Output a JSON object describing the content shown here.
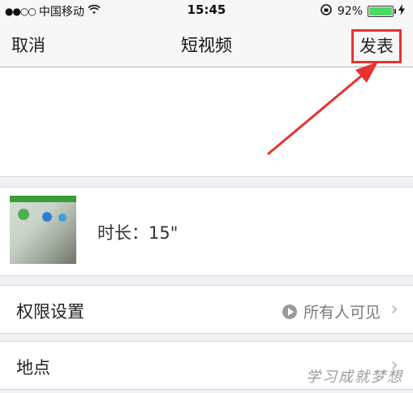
{
  "status_bar": {
    "signal_dots": "●●○○",
    "carrier": "中国移动",
    "time": "15:45",
    "battery": "92%"
  },
  "nav": {
    "cancel": "取消",
    "title": "短视频",
    "publish": "发表",
    "highlight_color": "#e8322f"
  },
  "video": {
    "duration": "时长：15\""
  },
  "rows": {
    "privacy": {
      "label": "权限设置",
      "value": "所有人可见"
    },
    "location": {
      "label": "地点"
    }
  },
  "watermark": "学习成就梦想"
}
